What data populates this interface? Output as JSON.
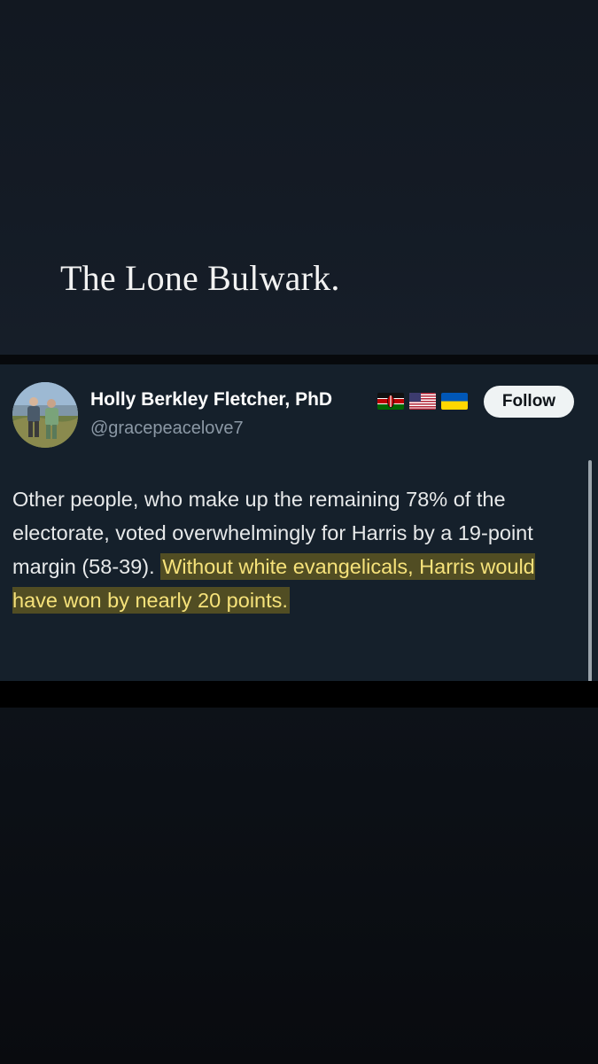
{
  "header": {
    "title": "The Lone Bulwark."
  },
  "tweet": {
    "author_name": "Holly Berkley Fletcher, PhD",
    "handle": "@gracepeacelove7",
    "follow_label": "Follow",
    "flags": [
      "kenya-flag-icon",
      "usa-flag-icon",
      "ukraine-flag-icon"
    ],
    "text_plain": "Other people, who make up the remaining 78% of the electorate, voted overwhelmingly for Harris by a 19-point margin (58-39). ",
    "text_highlighted": "Without white evangelicals, Harris would have won by nearly 20 points.",
    "highlight_color": "#d1af14"
  },
  "colors": {
    "card_background": "#15202b",
    "follow_button": "#eff3f4",
    "handle": "#8b98a5"
  }
}
